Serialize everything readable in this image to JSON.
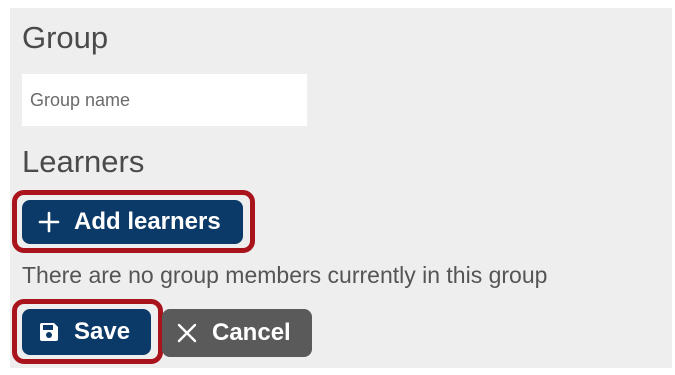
{
  "group_section": {
    "heading": "Group",
    "group_name_input": {
      "placeholder": "Group name",
      "value": ""
    }
  },
  "learners_section": {
    "heading": "Learners",
    "add_learners_label": "Add learners",
    "empty_message": "There are no group members currently in this group"
  },
  "actions": {
    "save_label": "Save",
    "cancel_label": "Cancel"
  },
  "icons": {
    "add": "plus-icon",
    "save": "floppy-disk-icon",
    "cancel": "close-icon"
  },
  "colors": {
    "primary_button": "#0b3a68",
    "secondary_button": "#5a5a5a",
    "highlight_outline": "#a8131c",
    "panel_background": "#eeeeee"
  }
}
